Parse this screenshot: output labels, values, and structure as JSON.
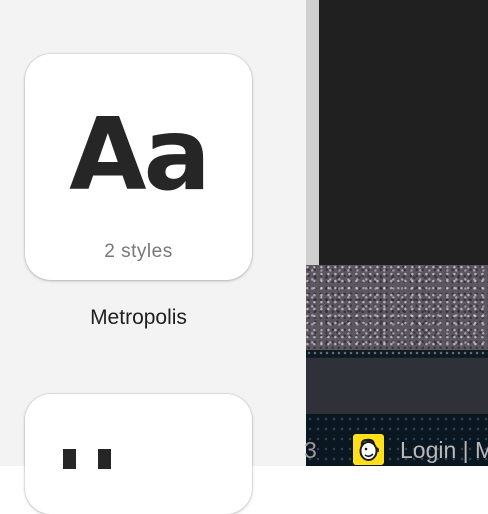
{
  "font_book": {
    "card": {
      "sample": "Aa",
      "styles": "2 styles",
      "name": "Metropolis"
    }
  },
  "background": {
    "tab_fragment": "3",
    "tab_icon": "mailchimp-icon",
    "tab_title": "Login | M"
  }
}
